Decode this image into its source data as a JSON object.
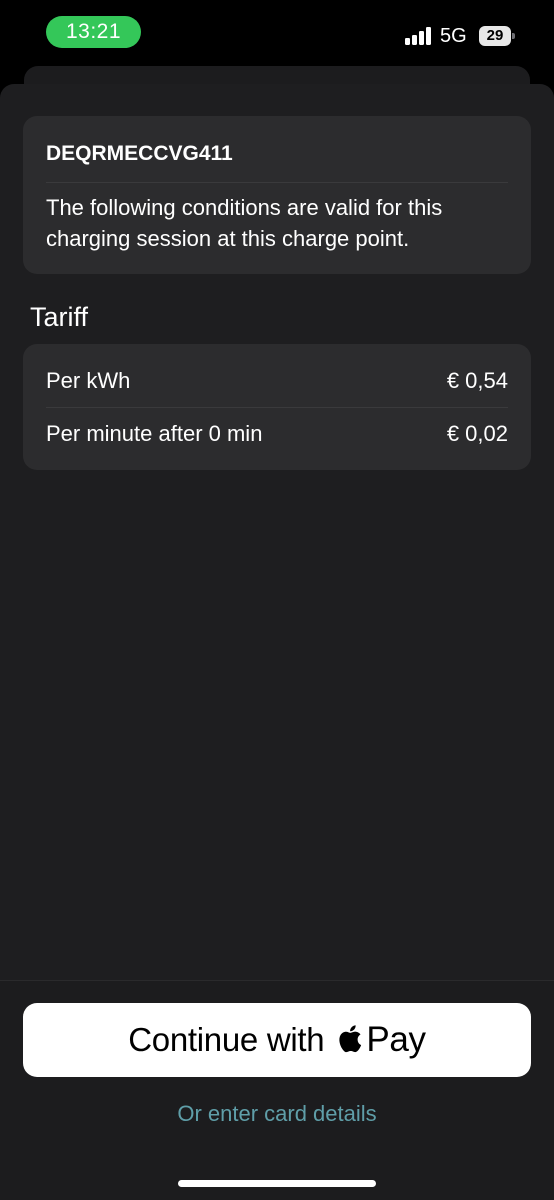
{
  "status_bar": {
    "time": "13:21",
    "network": "5G",
    "battery": "29"
  },
  "session": {
    "charge_point_id": "DEQRMECCVG411",
    "conditions_text": "The following conditions are valid for this charging session at this charge point."
  },
  "tariff": {
    "title": "Tariff",
    "rows": [
      {
        "label": "Per kWh",
        "value": "€ 0,54"
      },
      {
        "label": "Per minute after 0 min",
        "value": "€ 0,02"
      }
    ]
  },
  "actions": {
    "apple_pay_prefix": "Continue with",
    "apple_pay_suffix": "Pay",
    "card_details_link": "Or enter card details"
  },
  "colors": {
    "status_pill": "#34c759",
    "link": "#5f9ea8",
    "card_background": "#2c2c2e",
    "sheet_background": "#1e1e20"
  },
  "icons": {
    "signal": "cellular-signal-icon",
    "battery": "battery-icon",
    "apple": "apple-logo-icon"
  }
}
